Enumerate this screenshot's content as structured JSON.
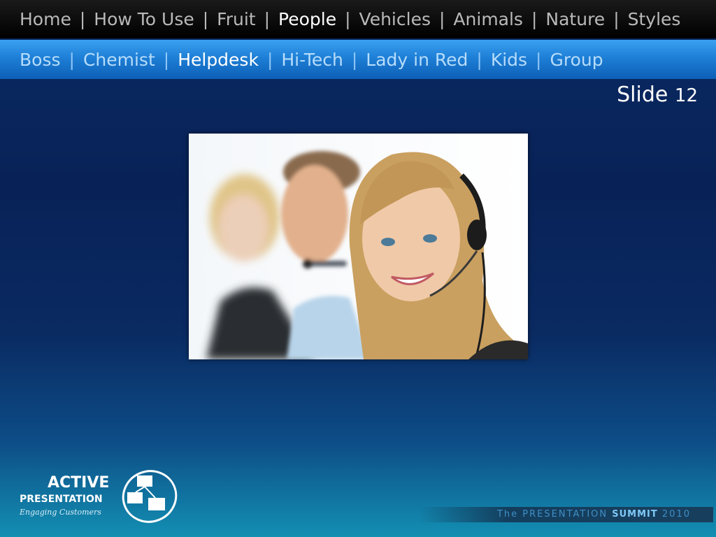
{
  "top_nav": {
    "items": [
      {
        "label": "Home",
        "active": false
      },
      {
        "label": "How To Use",
        "active": false
      },
      {
        "label": "Fruit",
        "active": false
      },
      {
        "label": "People",
        "active": true
      },
      {
        "label": "Vehicles",
        "active": false
      },
      {
        "label": "Animals",
        "active": false
      },
      {
        "label": "Nature",
        "active": false
      },
      {
        "label": "Styles",
        "active": false
      }
    ],
    "separator": "|"
  },
  "sub_nav": {
    "items": [
      {
        "label": "Boss",
        "active": false
      },
      {
        "label": "Chemist",
        "active": false
      },
      {
        "label": "Helpdesk",
        "active": true
      },
      {
        "label": "Hi-Tech",
        "active": false
      },
      {
        "label": "Lady in Red",
        "active": false
      },
      {
        "label": "Kids",
        "active": false
      },
      {
        "label": "Group",
        "active": false
      }
    ],
    "separator": "|"
  },
  "slide": {
    "label": "Slide",
    "number": "12"
  },
  "logo": {
    "line1": "ACTIVE",
    "line2": "PRESENTATION",
    "tagline": "Engaging Customers"
  },
  "footer": {
    "summit_prefix": "The PRESENTATION",
    "summit_bold": "SUMMIT",
    "summit_year": "2010"
  },
  "colors": {
    "top_nav_active": "#ffffff",
    "top_nav_inactive": "#b9b9b9",
    "sub_nav_active": "#ffffff",
    "sub_nav_inactive": "#b6dcfb",
    "sub_nav_bg": "#1e7fd6"
  }
}
